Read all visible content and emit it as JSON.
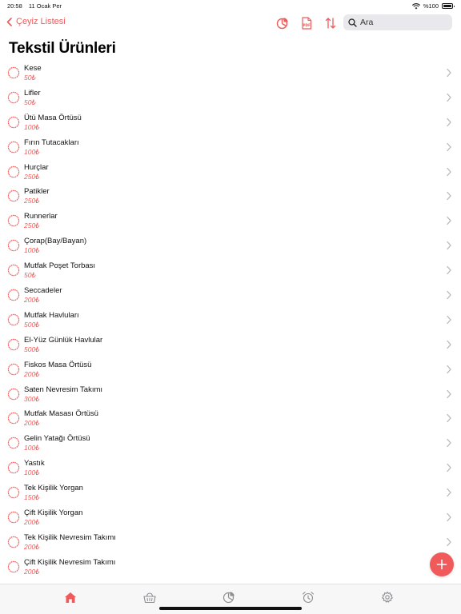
{
  "status_bar": {
    "time": "20:58",
    "date": "11 Ocak Per",
    "battery_text": "%100",
    "battery_level": 1.0
  },
  "nav": {
    "back_label": "Çeyiz Listesi",
    "back_icon": "chevron-left-icon"
  },
  "toolbar": {
    "icons": [
      "pie-chart-icon",
      "pdf-icon",
      "sort-icon"
    ]
  },
  "search": {
    "placeholder": "Ara"
  },
  "page_title": "Tekstil Ürünleri",
  "items": [
    {
      "name": "Kese",
      "price": "50₺"
    },
    {
      "name": "Lifler",
      "price": "50₺"
    },
    {
      "name": "Ütü Masa Örtüsü",
      "price": "100₺"
    },
    {
      "name": "Fırın Tutacakları",
      "price": "100₺"
    },
    {
      "name": "Hurçlar",
      "price": "250₺"
    },
    {
      "name": "Patikler",
      "price": "250₺"
    },
    {
      "name": "Runnerlar",
      "price": "250₺"
    },
    {
      "name": "Çorap(Bay/Bayan)",
      "price": "100₺"
    },
    {
      "name": "Mutfak Poşet Torbası",
      "price": "50₺"
    },
    {
      "name": "Seccadeler",
      "price": "200₺"
    },
    {
      "name": "Mutfak Havluları",
      "price": "500₺"
    },
    {
      "name": "El-Yüz Günlük Havlular",
      "price": "500₺"
    },
    {
      "name": "Fiskos Masa Örtüsü",
      "price": "200₺"
    },
    {
      "name": "Saten Nevresim Takımı",
      "price": "300₺"
    },
    {
      "name": "Mutfak Masası Örtüsü",
      "price": "200₺"
    },
    {
      "name": "Gelin Yatağı Örtüsü",
      "price": "100₺"
    },
    {
      "name": "Yastık",
      "price": "100₺"
    },
    {
      "name": "Tek Kişilik Yorgan",
      "price": "150₺"
    },
    {
      "name": "Çift Kişilik Yorgan",
      "price": "200₺"
    },
    {
      "name": "Tek Kişilik Nevresim Takımı",
      "price": "200₺"
    },
    {
      "name": "Çift Kişilik Nevresim Takımı",
      "price": "200₺"
    }
  ],
  "tabs": [
    {
      "icon": "home-icon",
      "active": true
    },
    {
      "icon": "basket-icon",
      "active": false
    },
    {
      "icon": "pie-chart-icon",
      "active": false
    },
    {
      "icon": "alarm-icon",
      "active": false
    },
    {
      "icon": "gear-icon",
      "active": false
    }
  ],
  "colors": {
    "accent": "#ef5b5b",
    "text": "#111111",
    "inactive_icon": "#8e8e93",
    "tab_bar_bg": "#f7f7f7"
  }
}
